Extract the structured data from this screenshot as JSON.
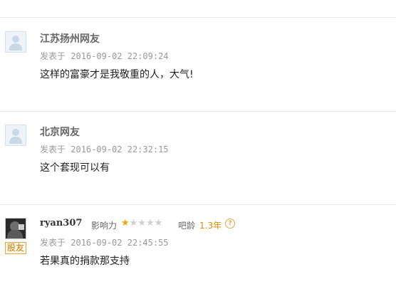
{
  "comments": [
    {
      "author": "江苏扬州网友",
      "time_label": "发表于",
      "time": "2016-09-02 22:09:24",
      "text": "这样的富豪才是我敬重的人，大气!"
    },
    {
      "author": "北京网友",
      "time_label": "发表于",
      "time": "2016-09-02 22:32:15",
      "text": "这个套现可以有"
    },
    {
      "author": "ryan307",
      "influence_label": "影响力",
      "influence_stars": 1,
      "influence_max": 5,
      "age_label": "吧龄",
      "age_value": "1.3年",
      "badge": "股友",
      "time_label": "发表于",
      "time": "2016-09-02 22:45:55",
      "text": "若果真的捐款那支持"
    }
  ],
  "icons": {
    "default_avatar": "default-avatar-icon",
    "user_avatar": "user-photo-avatar",
    "star": "star-icon",
    "help": "question-circle-icon"
  },
  "colors": {
    "separator": "#dfe8ef",
    "star_on": "#f0a800",
    "star_off": "#cfcfcf",
    "badge": "#d07c00"
  }
}
